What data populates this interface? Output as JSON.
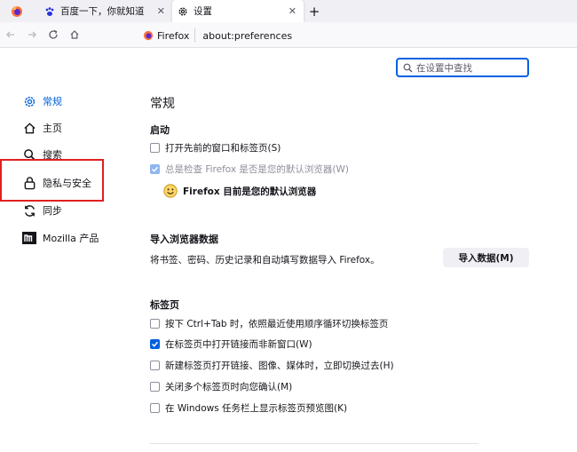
{
  "tabs": [
    {
      "label": "",
      "icon": "firefox-icon",
      "pinned": true
    },
    {
      "label": "百度一下，你就知道",
      "icon": "baidu-paw-icon"
    },
    {
      "label": "设置",
      "icon": "gear-icon",
      "active": true
    }
  ],
  "new_tab_label": "+",
  "tab_close_label": "✕",
  "urlbar": {
    "identity": "Firefox",
    "url": "about:preferences"
  },
  "search": {
    "placeholder": "在设置中查找"
  },
  "sidebar": {
    "items": [
      {
        "label": "常规",
        "icon": "gear-icon",
        "active": true
      },
      {
        "label": "主页",
        "icon": "home-icon"
      },
      {
        "label": "搜索",
        "icon": "search-icon"
      },
      {
        "label": "隐私与安全",
        "icon": "lock-icon"
      },
      {
        "label": "同步",
        "icon": "sync-icon"
      },
      {
        "label": "Mozilla 产品",
        "icon": "mozilla-icon"
      }
    ]
  },
  "main": {
    "title": "常规",
    "startup": {
      "heading": "启动",
      "restore_session": "打开先前的窗口和标签页(S)",
      "check_default": "总是检查 Firefox 是否是您的默认浏览器(W)",
      "default_status": "Firefox 目前是您的默认浏览器"
    },
    "import": {
      "heading": "导入浏览器数据",
      "description": "将书签、密码、历史记录和自动填写数据导入 Firefox。",
      "button": "导入数据(M)"
    },
    "tabs_section": {
      "heading": "标签页",
      "options": [
        {
          "label": "按下 Ctrl+Tab 时，依照最近使用顺序循环切换标签页",
          "checked": false
        },
        {
          "label": "在标签页中打开链接而非新窗口(W)",
          "checked": true
        },
        {
          "label": "新建标签页打开链接、图像、媒体时，立即切换过去(H)",
          "checked": false
        },
        {
          "label": "关闭多个标签页时向您确认(M)",
          "checked": false
        },
        {
          "label": "在 Windows 任务栏上显示标签页预览图(K)",
          "checked": false
        }
      ]
    }
  },
  "colors": {
    "accent": "#0061e0",
    "highlight": "#e02020"
  }
}
